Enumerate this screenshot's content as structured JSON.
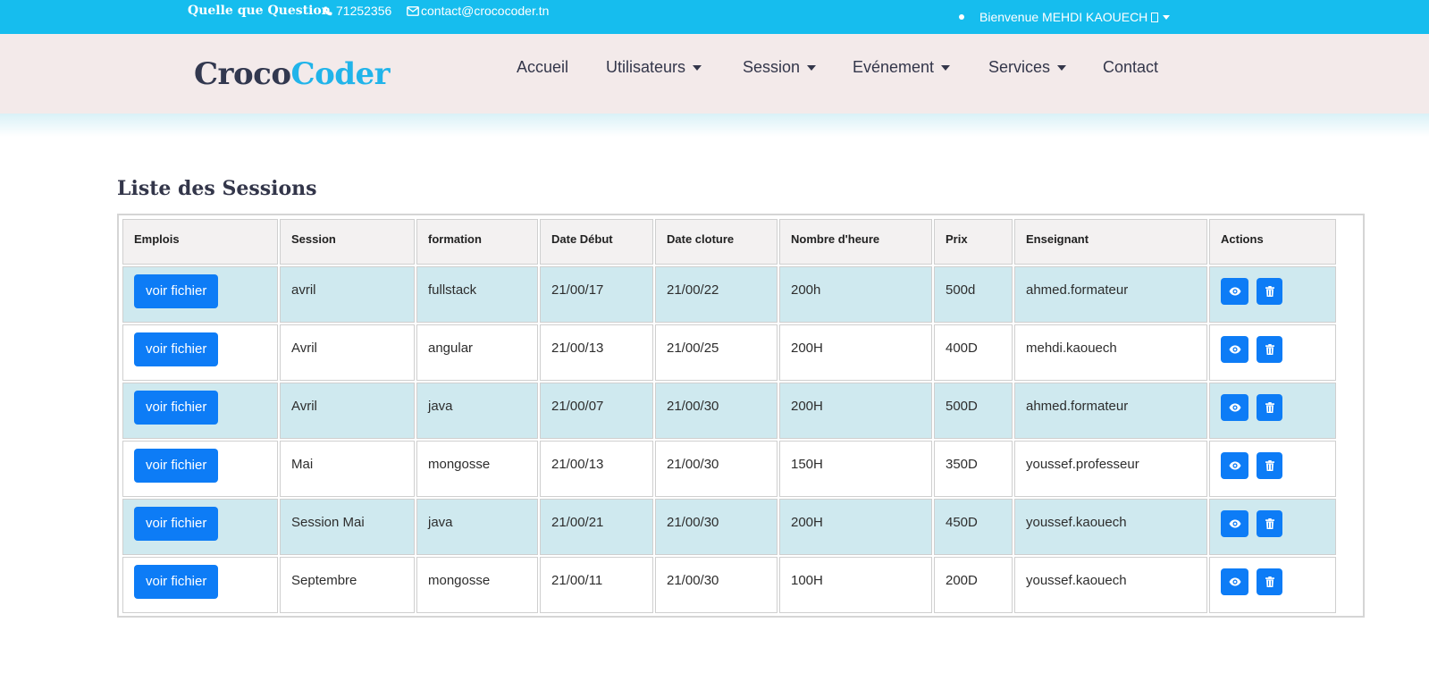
{
  "topbar": {
    "question": "Quelle que Question",
    "phone": "71252356",
    "email": "contact@crococoder.tn",
    "user_greeting": "Bienvenue MEHDI KAOUECH"
  },
  "brand": {
    "part1": "Croco",
    "part2": "Coder"
  },
  "nav": {
    "items": [
      {
        "label": "Accueil",
        "dropdown": false
      },
      {
        "label": "Utilisateurs",
        "dropdown": true
      },
      {
        "label": "Session",
        "dropdown": true
      },
      {
        "label": "Evénement",
        "dropdown": true
      },
      {
        "label": "Services",
        "dropdown": true
      },
      {
        "label": "Contact",
        "dropdown": false
      }
    ]
  },
  "page": {
    "title": "Liste des Sessions"
  },
  "table": {
    "headers": [
      "Emplois",
      "Session",
      "formation",
      "Date Début",
      "Date cloture",
      "Nombre d'heure",
      "Prix",
      "Enseignant",
      "Actions"
    ],
    "file_button_label": "voir fichier",
    "rows": [
      {
        "session": "avril",
        "formation": "fullstack",
        "date_debut": "21/00/17",
        "date_cloture": "21/00/22",
        "heures": "200h",
        "prix": "500d",
        "enseignant": "ahmed.formateur"
      },
      {
        "session": "Avril",
        "formation": "angular",
        "date_debut": "21/00/13",
        "date_cloture": "21/00/25",
        "heures": "200H",
        "prix": "400D",
        "enseignant": "mehdi.kaouech"
      },
      {
        "session": "Avril",
        "formation": "java",
        "date_debut": "21/00/07",
        "date_cloture": "21/00/30",
        "heures": "200H",
        "prix": "500D",
        "enseignant": "ahmed.formateur"
      },
      {
        "session": "Mai",
        "formation": "mongosse",
        "date_debut": "21/00/13",
        "date_cloture": "21/00/30",
        "heures": "150H",
        "prix": "350D",
        "enseignant": "youssef.professeur"
      },
      {
        "session": "Session Mai",
        "formation": "java",
        "date_debut": "21/00/21",
        "date_cloture": "21/00/30",
        "heures": "200H",
        "prix": "450D",
        "enseignant": "youssef.kaouech"
      },
      {
        "session": "Septembre",
        "formation": "mongosse",
        "date_debut": "21/00/11",
        "date_cloture": "21/00/30",
        "heures": "100H",
        "prix": "200D",
        "enseignant": "youssef.kaouech"
      }
    ]
  },
  "colors": {
    "topbar": "#16bdee",
    "navbar": "#f3eaea",
    "brand_dark": "#32384f",
    "brand_accent": "#21b4ea",
    "button": "#0d7cf6",
    "row_alt": "#cfe9ef"
  },
  "icons": {
    "phone": "phone-icon",
    "email": "envelope-icon",
    "view": "eye-icon",
    "delete": "trash-icon"
  }
}
